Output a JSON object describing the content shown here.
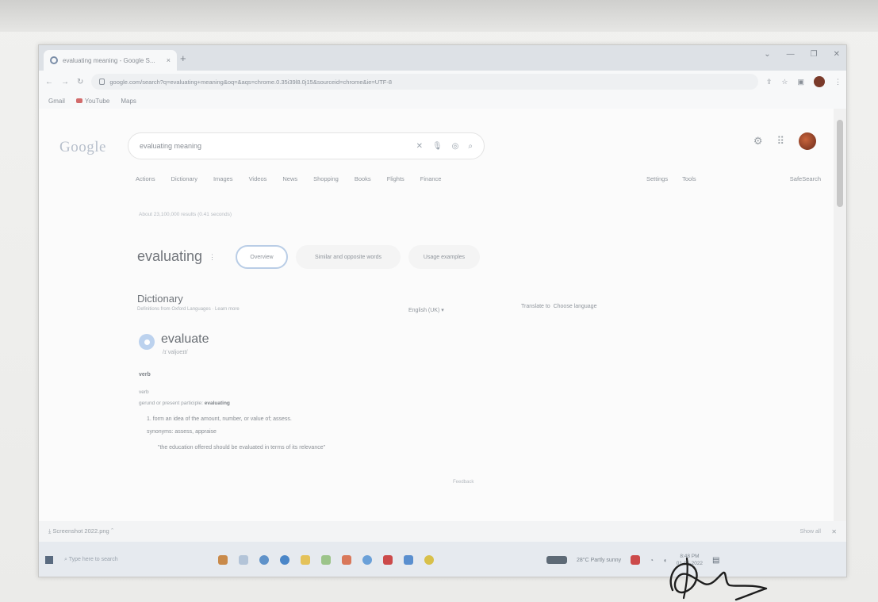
{
  "browser": {
    "tab_title": "evaluating meaning - Google S...",
    "tab_close": "×",
    "new_tab": "+",
    "window_controls": [
      "⌄",
      "—",
      "❐",
      "✕"
    ],
    "url": "google.com/search?q=evaluating+meaning&oq=&aqs=chrome.0.35i39l8.0j15&sourceid=chrome&ie=UTF-8",
    "bookmarks": [
      "Gmail",
      "YouTube",
      "Maps"
    ]
  },
  "google": {
    "logo": "Google",
    "query": "evaluating meaning",
    "filters": [
      "Actions",
      "Dictionary",
      "Images",
      "Videos",
      "News",
      "Shopping",
      "Books",
      "Flights",
      "Finance"
    ],
    "filters_right": [
      "Settings",
      "Tools"
    ],
    "safesearch": "SafeSearch",
    "results_count": "About 23,100,000 results (0.41 seconds)",
    "heading": "evaluating",
    "chips": [
      "Overview",
      "Similar and opposite words",
      "Usage examples"
    ],
    "dictionary": {
      "title": "Dictionary",
      "subtitle": "Definitions from Oxford Languages · Learn more",
      "language": "English (UK)",
      "translate_label": "Translate to",
      "translate_value": "Choose language",
      "word": "evaluate",
      "phonetic": "/ɪˈvaljʊeɪt/",
      "pos": "verb",
      "section": "verb",
      "forms_prefix": "gerund or present participle: ",
      "forms_word": "evaluating",
      "def1": "1. form an idea of the amount, number, or value of; assess.",
      "def2": "synonyms: assess, appraise",
      "example": "\"the education offered should be evaluated in terms of its relevance\"",
      "feedback": "Feedback"
    }
  },
  "downloads": {
    "file": "Screenshot 2022.png",
    "show_all": "Show all",
    "close": "✕"
  },
  "taskbar": {
    "search_placeholder": "Type here to search",
    "weather": "28°C Partly sunny",
    "time": "8:48 PM",
    "date": "01-05-2022"
  }
}
